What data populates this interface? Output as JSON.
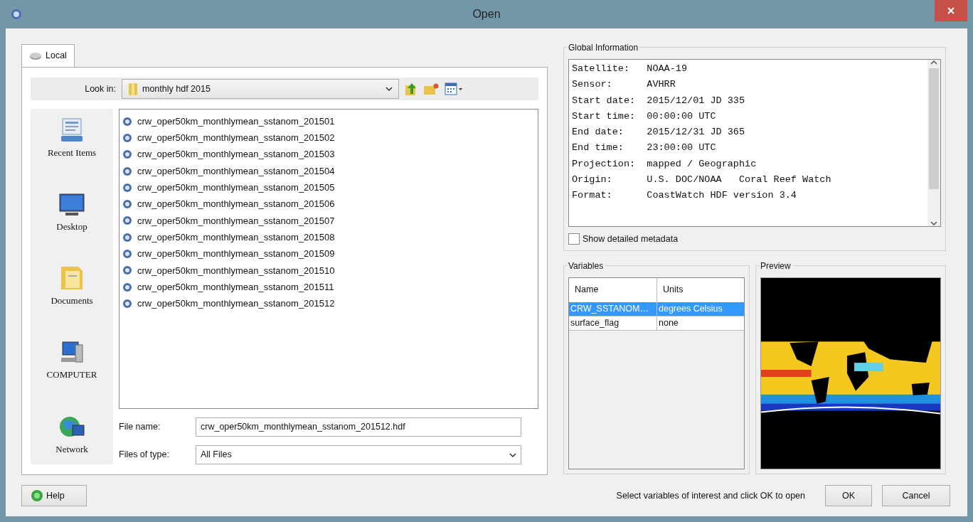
{
  "window": {
    "title": "Open"
  },
  "tabs": [
    {
      "label": "Local",
      "selected": true
    }
  ],
  "look_in": {
    "label": "Look in:",
    "value": "monthly hdf 2015"
  },
  "places": [
    {
      "label": "Recent Items"
    },
    {
      "label": "Desktop"
    },
    {
      "label": "Documents"
    },
    {
      "label": "COMPUTER"
    },
    {
      "label": "Network"
    }
  ],
  "files": [
    "crw_oper50km_monthlymean_sstanom_201501",
    "crw_oper50km_monthlymean_sstanom_201502",
    "crw_oper50km_monthlymean_sstanom_201503",
    "crw_oper50km_monthlymean_sstanom_201504",
    "crw_oper50km_monthlymean_sstanom_201505",
    "crw_oper50km_monthlymean_sstanom_201506",
    "crw_oper50km_monthlymean_sstanom_201507",
    "crw_oper50km_monthlymean_sstanom_201508",
    "crw_oper50km_monthlymean_sstanom_201509",
    "crw_oper50km_monthlymean_sstanom_201510",
    "crw_oper50km_monthlymean_sstanom_201511",
    "crw_oper50km_monthlymean_sstanom_201512"
  ],
  "file_name": {
    "label": "File name:",
    "value": "crw_oper50km_monthlymean_sstanom_201512.hdf"
  },
  "files_of_type": {
    "label": "Files of type:",
    "value": "All Files"
  },
  "global_information": {
    "title": "Global Information",
    "rows": [
      {
        "key": "Satellite:",
        "value": "NOAA-19"
      },
      {
        "key": "Sensor:",
        "value": "AVHRR"
      },
      {
        "key": "Start date:",
        "value": "2015/12/01 JD 335"
      },
      {
        "key": "Start time:",
        "value": "00:00:00 UTC"
      },
      {
        "key": "End date:",
        "value": "2015/12/31 JD 365"
      },
      {
        "key": "End time:",
        "value": "23:00:00 UTC"
      },
      {
        "key": "Projection:",
        "value": "mapped / Geographic"
      },
      {
        "key": "Origin:",
        "value": "U.S. DOC/NOAA   Coral Reef Watch"
      },
      {
        "key": "Format:",
        "value": "CoastWatch HDF version 3.4"
      }
    ]
  },
  "show_detailed_metadata": {
    "label": "Show detailed metadata",
    "checked": false
  },
  "variables": {
    "title": "Variables",
    "columns": [
      "Name",
      "Units"
    ],
    "rows": [
      {
        "name": "CRW_SSTANOM…",
        "units": "degrees Celsius",
        "selected": true
      },
      {
        "name": "surface_flag",
        "units": "none",
        "selected": false
      }
    ]
  },
  "preview": {
    "title": "Preview",
    "kind": "picture"
  },
  "help_button": "Help",
  "status_text": "Select variables of interest and click OK to open",
  "buttons": [
    "OK",
    "Cancel"
  ]
}
